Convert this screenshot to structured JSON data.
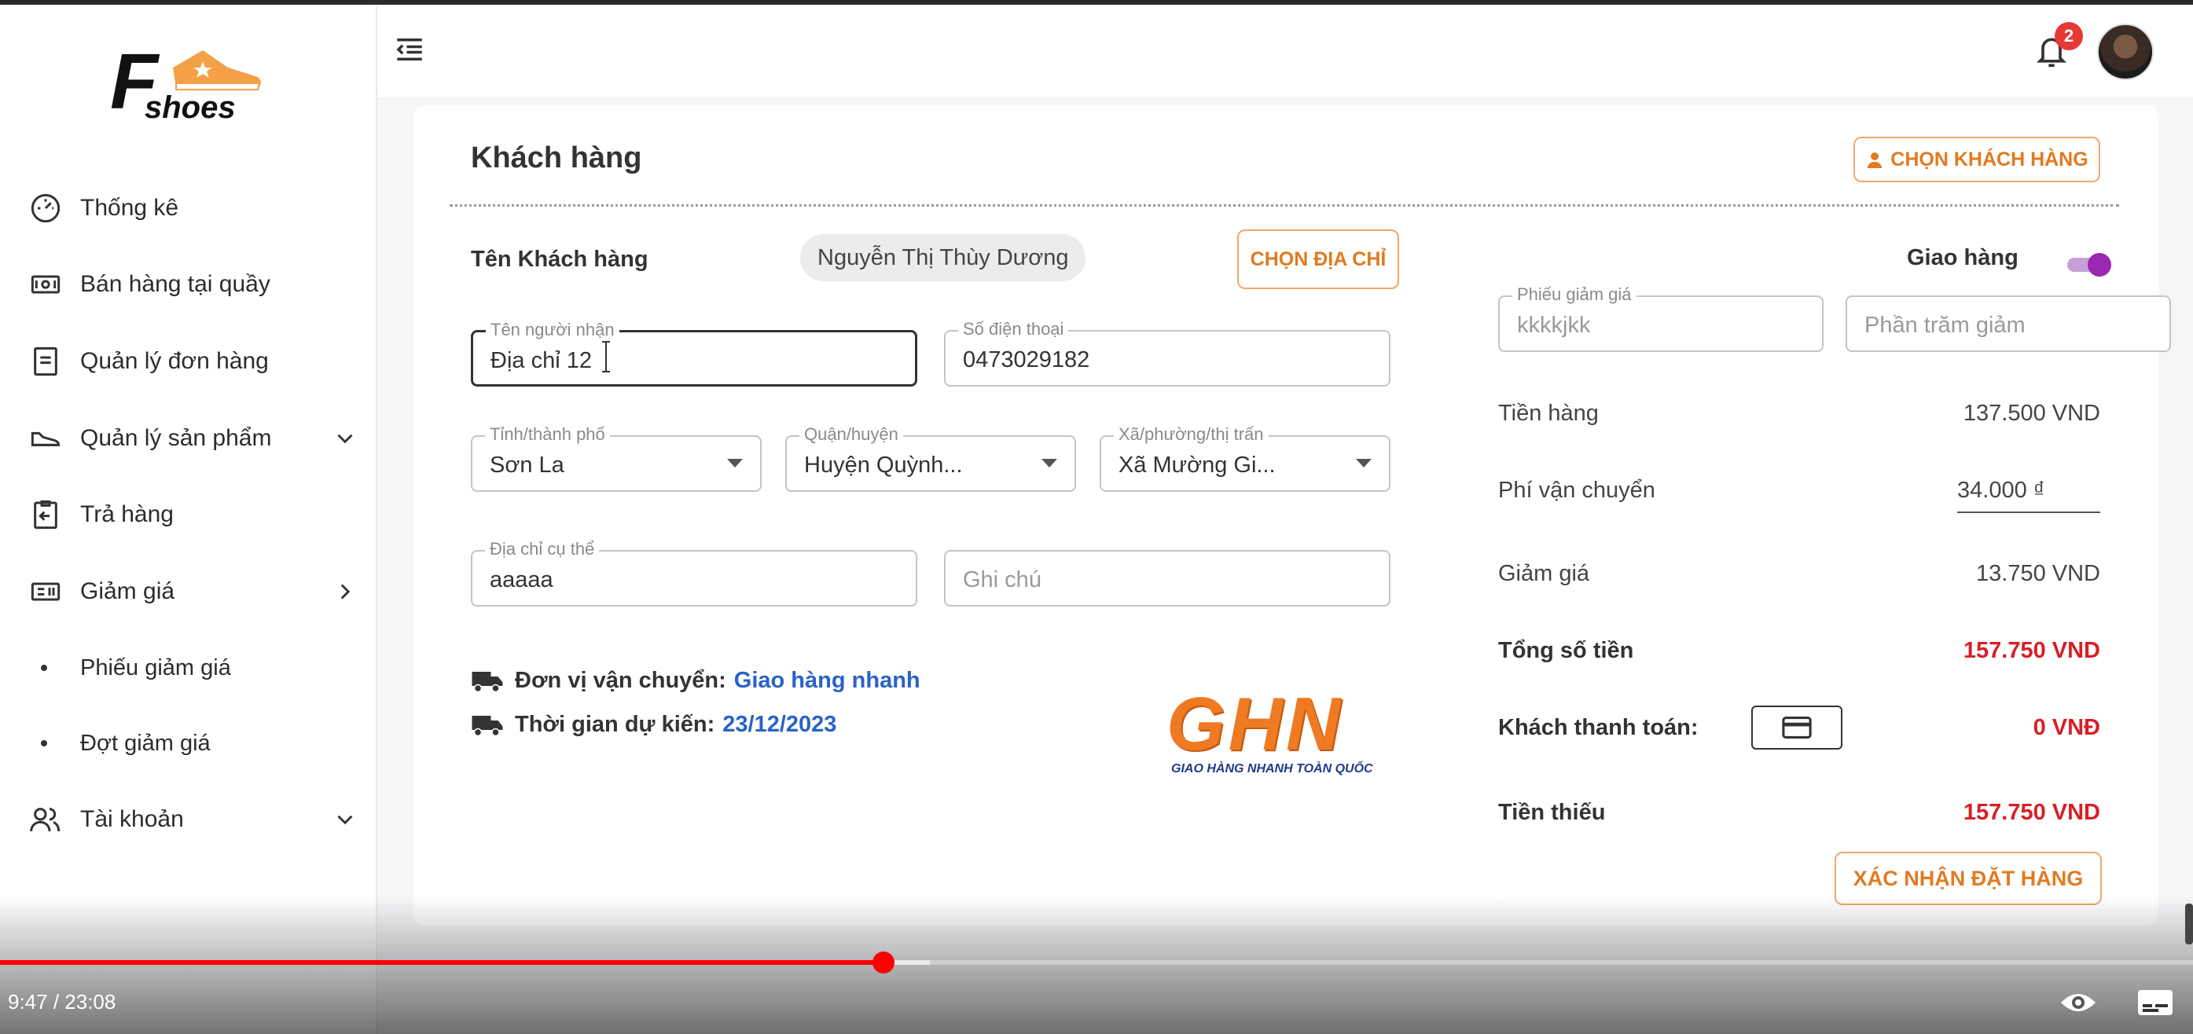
{
  "brand": {
    "logo_letter": "F",
    "logo_text": "shoes"
  },
  "sidebar": {
    "items": [
      {
        "label": "Thống kê",
        "icon": "dashboard-gauge-icon"
      },
      {
        "label": "Bán hàng tại quầy",
        "icon": "cash-icon"
      },
      {
        "label": "Quản lý đơn hàng",
        "icon": "document-icon"
      },
      {
        "label": "Quản lý sản phẩm",
        "icon": "shoe-icon",
        "chevron": "chevron-down-icon"
      },
      {
        "label": "Trả hàng",
        "icon": "return-icon"
      },
      {
        "label": "Giảm giá",
        "icon": "coupon-icon",
        "chevron": "chevron-right-icon"
      }
    ],
    "sub_items": [
      {
        "label": "Phiếu giảm giá"
      },
      {
        "label": "Đợt giảm giá"
      }
    ],
    "account": {
      "label": "Tài khoản",
      "icon": "users-icon",
      "chevron": "chevron-down-icon"
    }
  },
  "header": {
    "notification_count": "2"
  },
  "customer_card": {
    "title": "Khách hàng",
    "choose_customer_label": "CHỌN KHÁCH HÀNG",
    "customer_name_label": "Tên Khách hàng",
    "customer_name_value": "Nguyễn Thị Thùy Dương",
    "choose_address_label": "CHỌN ĐỊA CHỈ",
    "recipient": {
      "label": "Tên người nhận",
      "value": "Địa chỉ 12"
    },
    "phone": {
      "label": "Số điện thoại",
      "value": "0473029182"
    },
    "province": {
      "label": "Tỉnh/thành phố",
      "value": "Sơn La"
    },
    "district": {
      "label": "Quận/huyện",
      "value": "Huyện Quỳnh..."
    },
    "ward": {
      "label": "Xã/phường/thị trấn",
      "value": "Xã Mường Gi..."
    },
    "address_detail": {
      "label": "Địa chỉ cụ thể",
      "value": "aaaaa"
    },
    "note": {
      "placeholder": "Ghi chú"
    },
    "carrier_label": "Đơn vị vận chuyển:",
    "carrier_value": "Giao hàng nhanh",
    "eta_label": "Thời gian dự kiến:",
    "eta_value": "23/12/2023",
    "carrier_logo": "GHN",
    "carrier_logo_sub": "GIAO HÀNG NHANH TOÀN QUỐC"
  },
  "summary": {
    "delivery_label": "Giao hàng",
    "delivery_enabled": true,
    "voucher": {
      "label": "Phiếu giảm giá",
      "value": "kkkkjkk"
    },
    "percent_placeholder": "Phần trăm giảm",
    "goods_label": "Tiền hàng",
    "goods_value": "137.500 VND",
    "shipping_label": "Phí vận chuyển",
    "shipping_value": "34.000 ₫",
    "discount_label": "Giảm giá",
    "discount_value": "13.750 VND",
    "total_label": "Tổng số tiền",
    "total_value": "157.750 VND",
    "paid_label": "Khách thanh toán:",
    "paid_value": "0 VNĐ",
    "missing_label": "Tiền thiếu",
    "missing_value": "157.750 VND",
    "confirm_label": "XÁC NHẬN ĐẶT HÀNG"
  },
  "player": {
    "time": "9:47 / 23:08",
    "progress": 0.403,
    "buffered": 0.424
  },
  "colors": {
    "accent": "#e07b22",
    "danger": "#d81f26",
    "link": "#2962c9",
    "toggle": "#9c27b0"
  }
}
